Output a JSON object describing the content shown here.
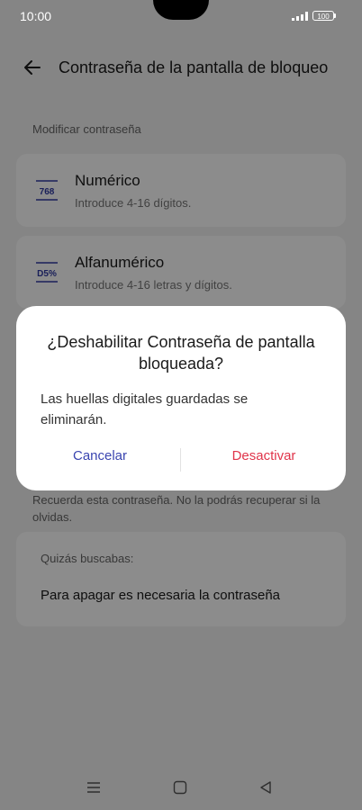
{
  "status": {
    "time": "10:00",
    "battery": "100"
  },
  "header": {
    "title": "Contraseña de la pantalla de bloqueo"
  },
  "section": {
    "label": "Modificar contraseña"
  },
  "options": [
    {
      "icon_text": "768",
      "title": "Numérico",
      "subtitle": "Introduce 4-16 dígitos."
    },
    {
      "icon_text": "D5%",
      "title": "Alfanumérico",
      "subtitle": "Introduce 4-16 letras y dígitos."
    }
  ],
  "note": "Recuerda esta contraseña. No la podrás recuperar si la olvidas.",
  "suggestions": {
    "heading": "Quizás buscabas:",
    "item": "Para apagar es necesaria la contraseña"
  },
  "dialog": {
    "title": "¿Deshabilitar Contraseña de pantalla bloqueada?",
    "message": "Las huellas digitales guardadas se eliminarán.",
    "cancel": "Cancelar",
    "confirm": "Desactivar"
  },
  "colors": {
    "accent": "#3a45b0",
    "danger": "#e0344a",
    "scrim": "rgba(0,0,0,0.45)"
  },
  "icons": [
    "back-arrow-icon",
    "signal-icon",
    "battery-icon",
    "menu-icon",
    "home-icon",
    "back-triangle-icon"
  ]
}
